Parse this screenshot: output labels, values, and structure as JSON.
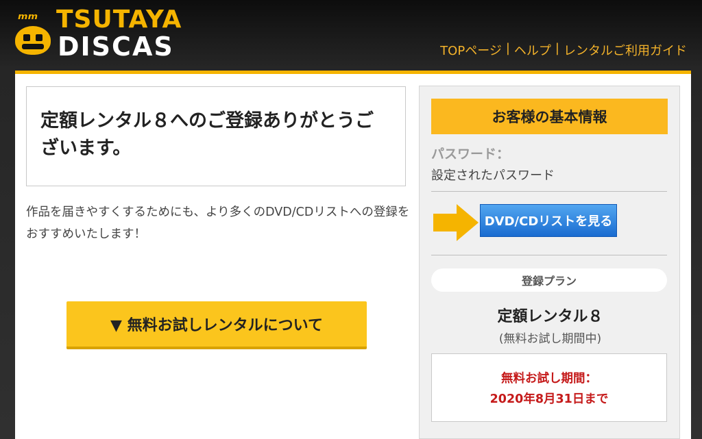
{
  "header": {
    "logo_top": "TSUTAYA",
    "logo_bottom": "DISCAS",
    "nav": [
      "TOPページ",
      "ヘルプ",
      "レンタルご利用ガイド"
    ]
  },
  "main": {
    "thanks_title": "定額レンタル８へのご登録ありがとうございます。",
    "recommend_text": "作品を届きやすくするためにも、より多くのDVD/CDリストへの登録をおすすめいたします！",
    "trial_button_label": "▼ 無料お試しレンタルについて"
  },
  "sidebar": {
    "header": "お客様の基本情報",
    "password_label": "パスワード：",
    "password_value": "設定されたパスワード",
    "dvd_button_label": "DVD/CDリストを見る",
    "plan_label": "登録プラン",
    "plan_name": "定額レンタル８",
    "plan_status": "(無料お試し期間中)",
    "trial_period_label": "無料お試し期間：",
    "trial_period_end": "2020年8月31日まで"
  },
  "colors": {
    "accent": "#f5b400",
    "button_yellow": "#fbc51d",
    "button_blue": "#1a6cd0",
    "alert_red": "#c51a1a"
  },
  "icons": {
    "logo": "tsutaya-face-logo",
    "arrow": "yellow-right-arrow-icon"
  }
}
